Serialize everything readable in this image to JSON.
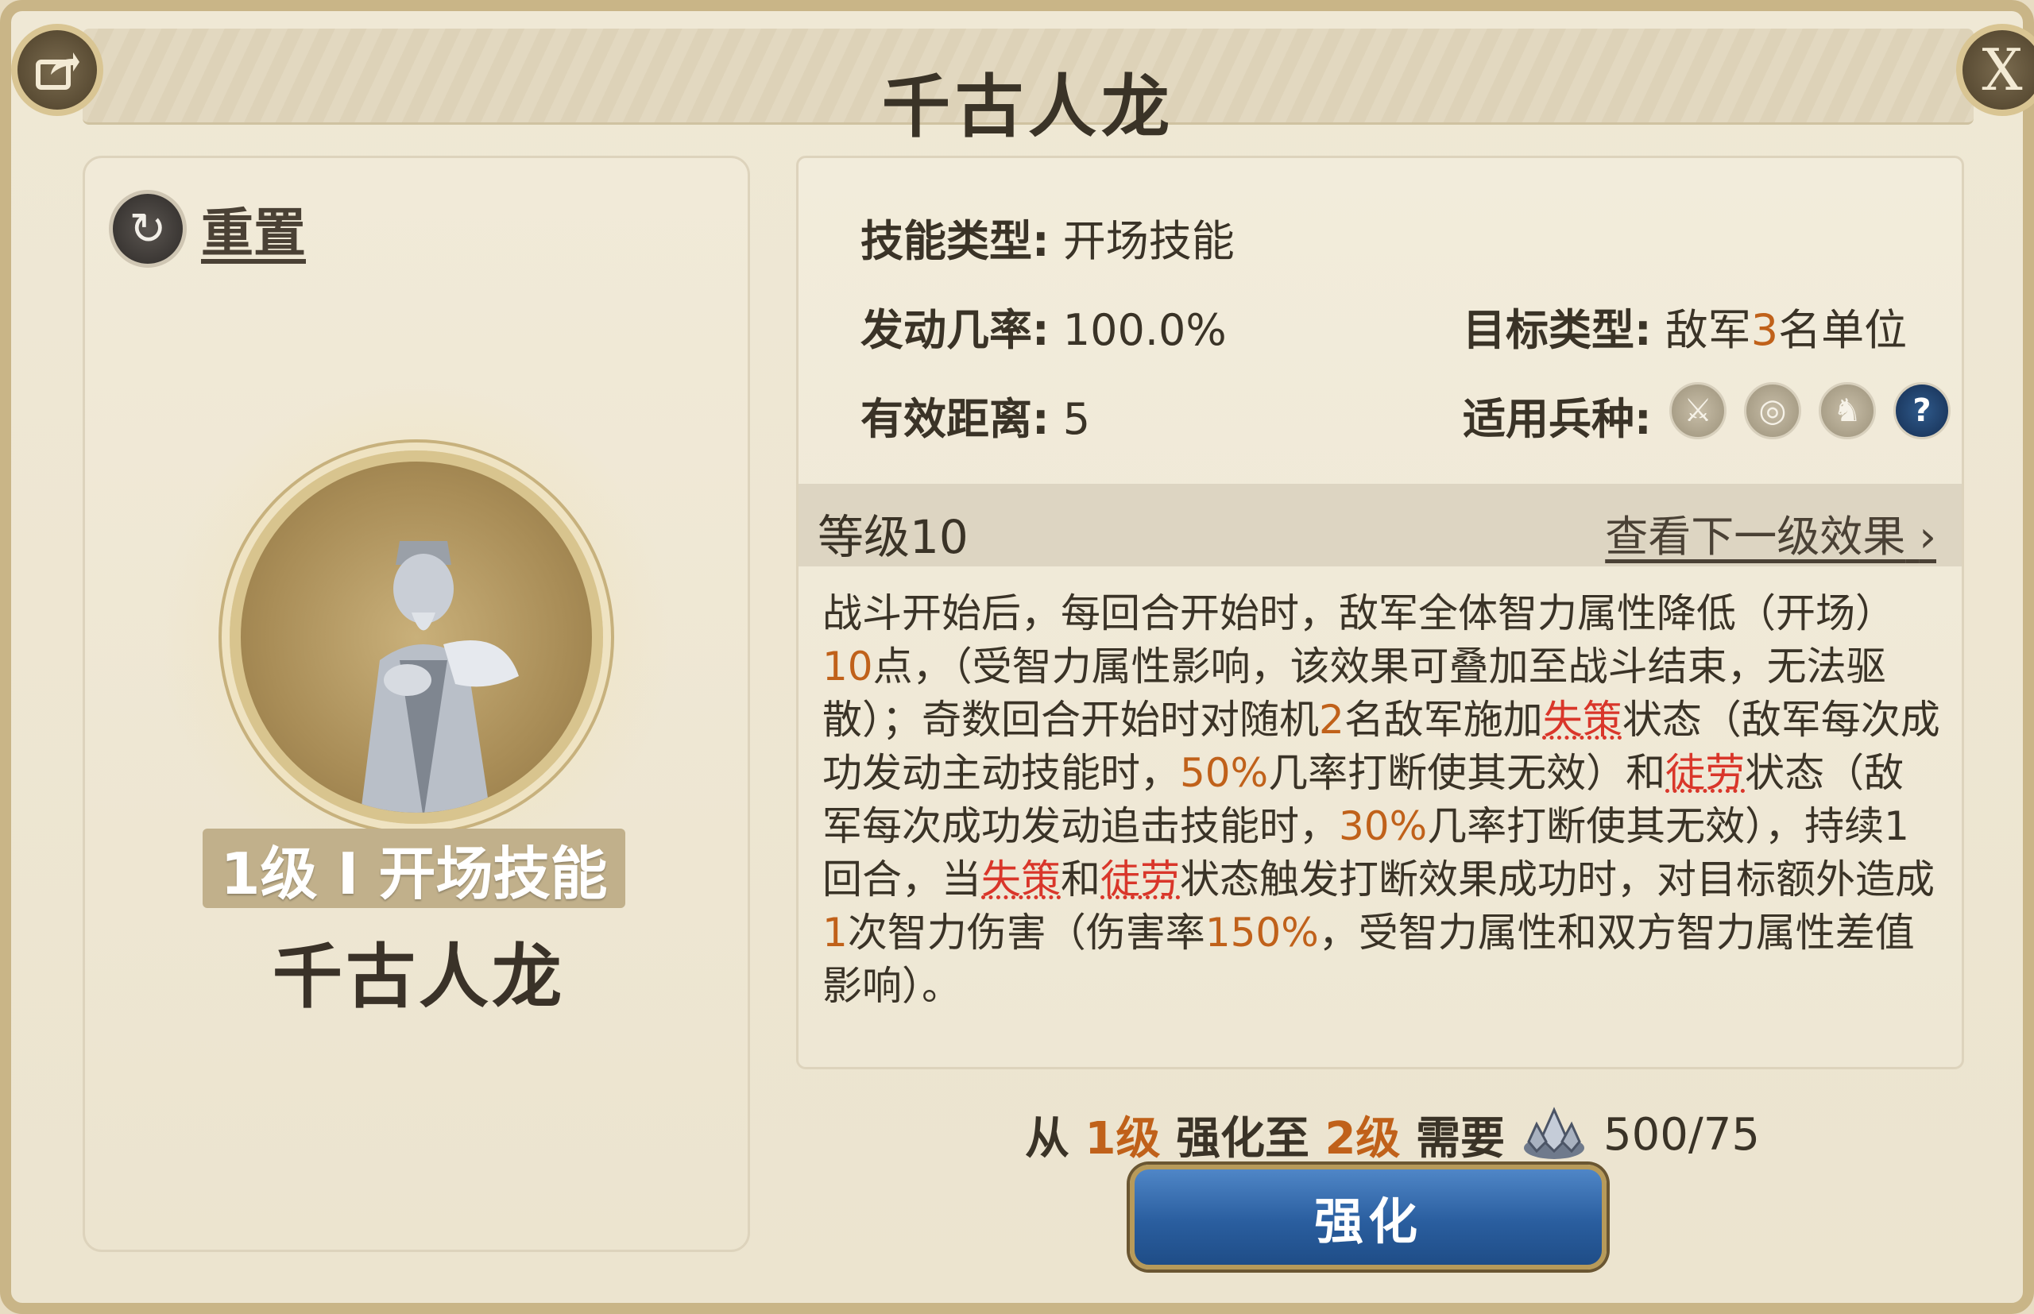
{
  "dialog": {
    "title": "千古人龙",
    "close_label": "X"
  },
  "left": {
    "reset_label": "重置",
    "level_badge": "1级 I 开场技能",
    "skill_name": "千古人龙"
  },
  "info": {
    "skill_type_label": "技能类型:",
    "skill_type_value": "开场技能",
    "rate_label": "发动几率:",
    "rate_value": "100.0%",
    "range_label": "有效距离:",
    "range_value": "5",
    "target_label": "目标类型:",
    "target_prefix": "敌军",
    "target_count": "3",
    "target_suffix": "名单位",
    "troop_label": "适用兵种:",
    "troop_icons": [
      "sword-icon",
      "bow-target-icon",
      "horse-icon",
      "help-icon"
    ]
  },
  "level": {
    "label": "等级10",
    "next_link": "查看下一级效果"
  },
  "description": {
    "p1": "战斗开始后，每回合开始时，敌军全体智力属性降低（开场）",
    "n1": "10",
    "p2": "点，（受智力属性影响，该效果可叠加至战斗结束，无法驱散）；奇数回合开始时对随机",
    "n2": "2",
    "p3": "名敌军施加",
    "k1": "失策",
    "p4": "状态（敌军每次成功发动主动技能时，",
    "n3": "50%",
    "p5": "几率打断使其无效）和",
    "k2": "徒劳",
    "p6": "状态（敌军每次成功发动追击技能时，",
    "n4": "30%",
    "p7": "几率打断使其无效），持续1回合，当",
    "k3": "失策",
    "p8": "和",
    "k4": "徒劳",
    "p9": "状态触发打断效果成功时，对目标额外造成",
    "n5": "1",
    "p10": "次智力伤害（伤害率",
    "n6": "150%",
    "p11": "，受智力属性和双方智力属性差值影响）。"
  },
  "upgrade": {
    "from_prefix": "从",
    "from_level": "1级",
    "middle": "强化至",
    "to_level": "2级",
    "need": "需要",
    "cost": "500/75",
    "button_label": "强化"
  },
  "colors": {
    "highlight_orange": "#c0611a",
    "keyword_red": "#d9362a",
    "button_blue": "#2a5e9f"
  }
}
